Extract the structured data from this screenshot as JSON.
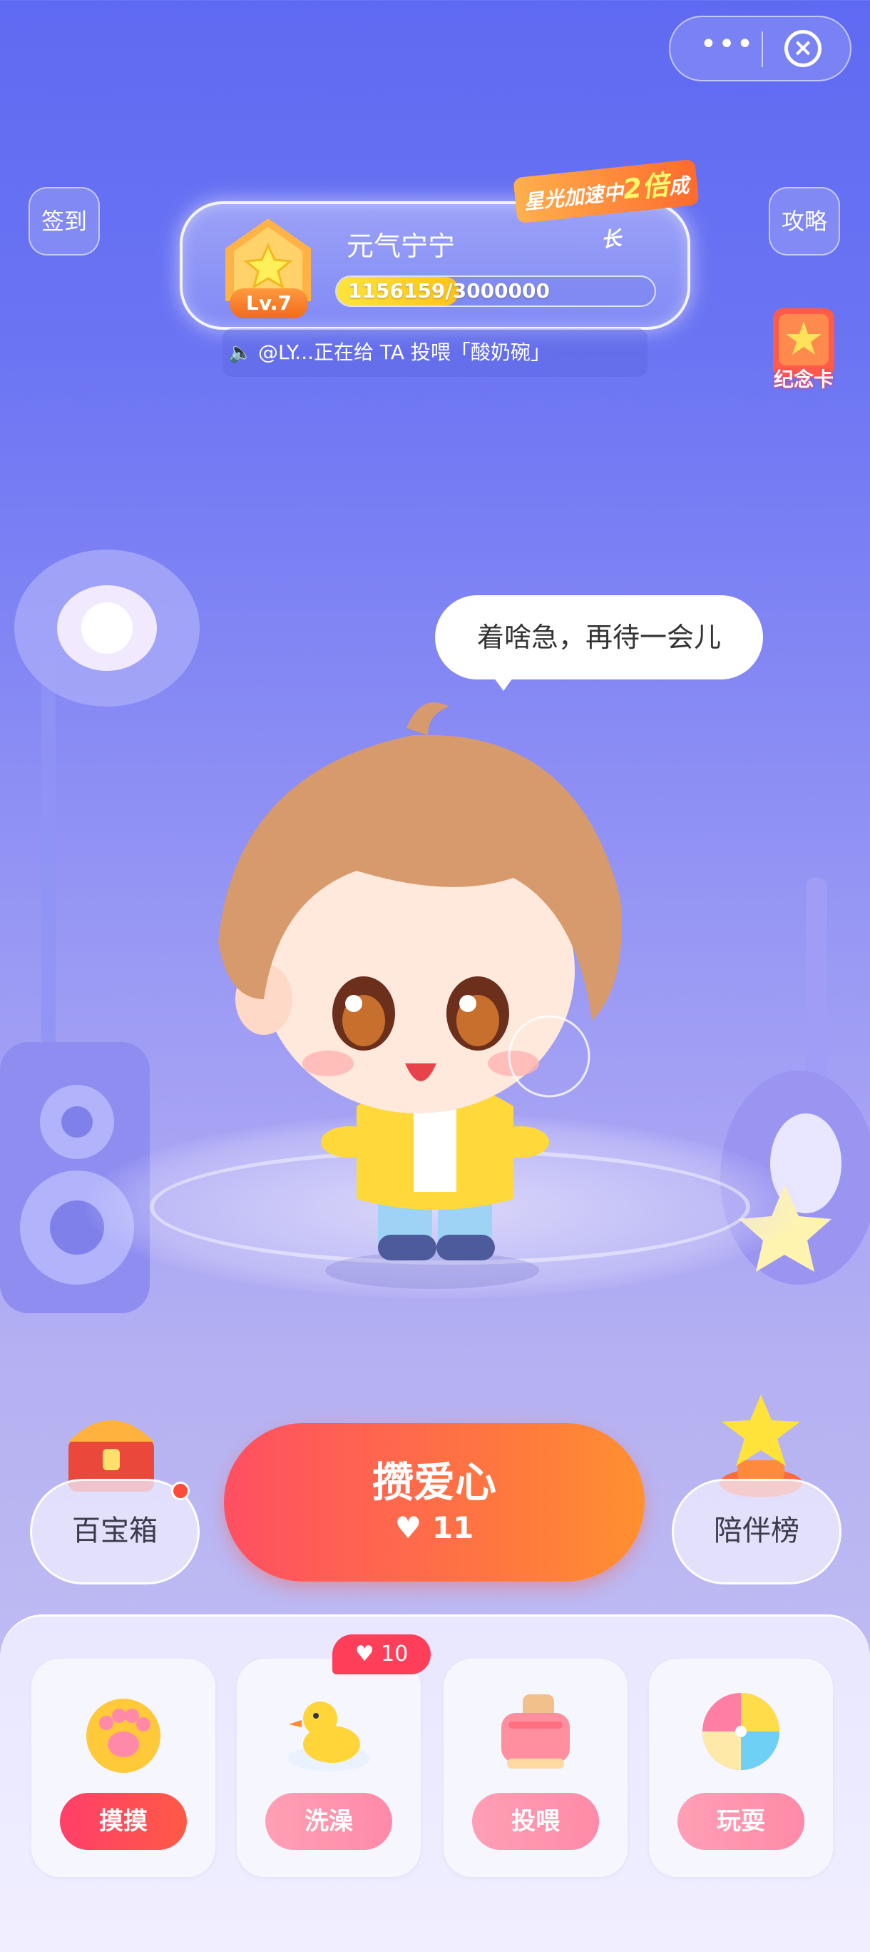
{
  "topbar": {
    "more_label": "•••",
    "close_label": "×"
  },
  "sidebar_left": {
    "checkin_label": "签到"
  },
  "sidebar_right": {
    "guide_label": "攻略",
    "memo_card_label": "纪念卡"
  },
  "pet": {
    "name": "元气宁宁",
    "level_label": "Lv.7",
    "progress_text": "1156159/3000000",
    "progress_fraction": 0.385,
    "promo_prefix": "星光加速中",
    "promo_multiplier": "2倍",
    "promo_suffix": "成长"
  },
  "ticker": {
    "text": "@LY...正在给 TA 投喂「酸奶碗」"
  },
  "speech": {
    "text": "着啥急，再待一会儿"
  },
  "actions": {
    "treasure_label": "百宝箱",
    "main_label": "攒爱心",
    "main_count": "11",
    "rank_label": "陪伴榜"
  },
  "cards": [
    {
      "label": "摸摸",
      "icon": "paw-icon"
    },
    {
      "label": "洗澡",
      "icon": "duck-icon",
      "cost": "10"
    },
    {
      "label": "投喂",
      "icon": "toaster-icon"
    },
    {
      "label": "玩耍",
      "icon": "beach-ball-icon"
    }
  ],
  "colors": {
    "primary_gradient_start": "#ff4f62",
    "primary_gradient_end": "#ff9030",
    "background_top": "#5f6af2",
    "progress_fill": "#ffe53b"
  }
}
